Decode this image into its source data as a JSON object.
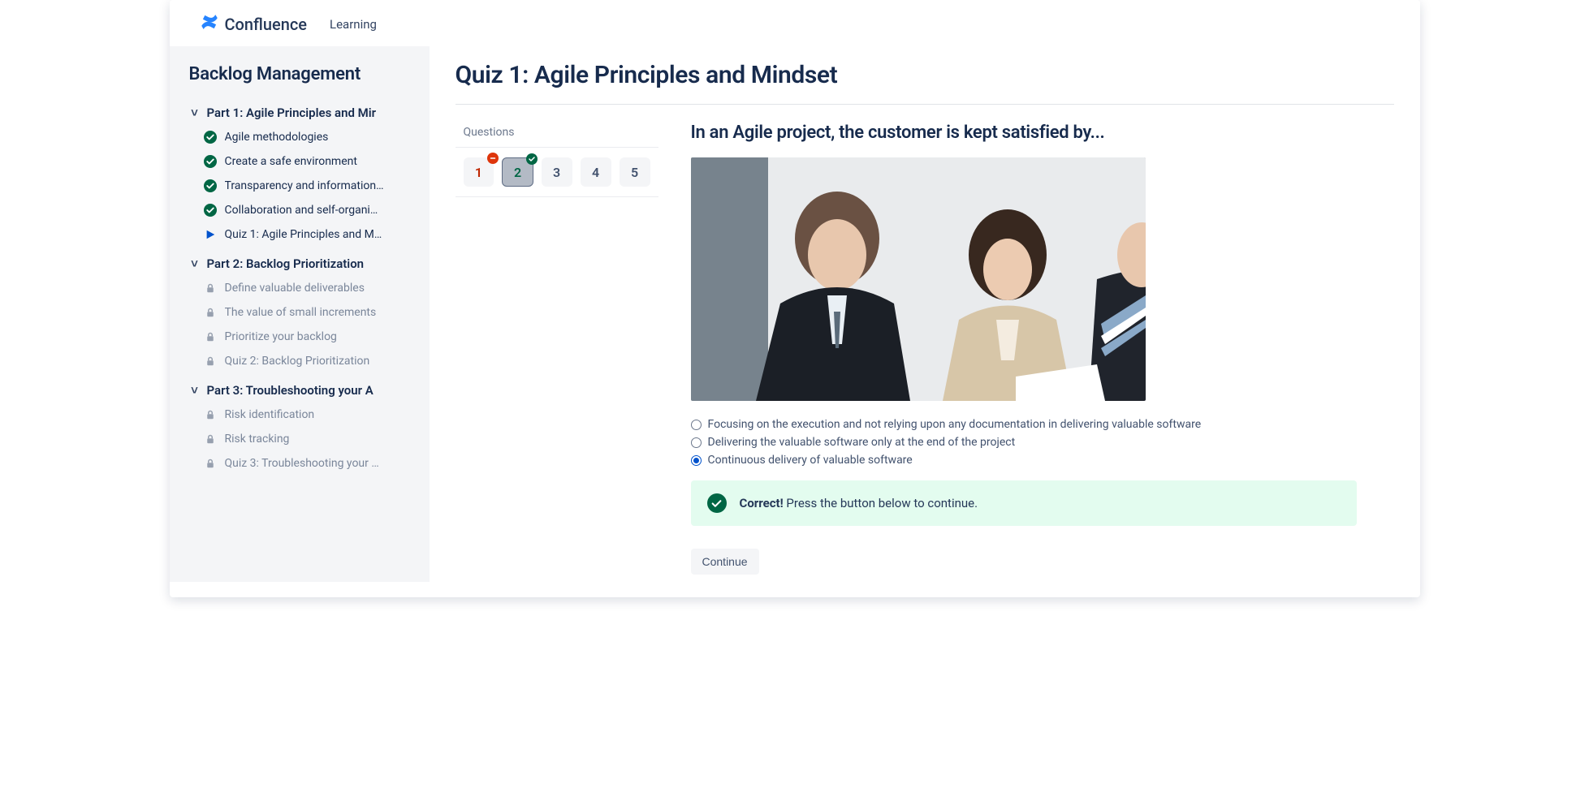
{
  "header": {
    "brand": "Confluence",
    "section": "Learning"
  },
  "sidebar": {
    "title": "Backlog Management",
    "parts": [
      {
        "label": "Part 1: Agile Principles and Mir",
        "items": [
          {
            "label": "Agile methodologies",
            "state": "done"
          },
          {
            "label": "Create a safe environment",
            "state": "done"
          },
          {
            "label": "Transparency and information…",
            "state": "done"
          },
          {
            "label": "Collaboration and self-organi…",
            "state": "done"
          },
          {
            "label": "Quiz 1: Agile Principles and M…",
            "state": "current"
          }
        ]
      },
      {
        "label": "Part 2: Backlog Prioritization",
        "items": [
          {
            "label": "Define valuable deliverables",
            "state": "locked"
          },
          {
            "label": "The value of small increments",
            "state": "locked"
          },
          {
            "label": "Prioritize your backlog",
            "state": "locked"
          },
          {
            "label": "Quiz 2: Backlog Prioritization",
            "state": "locked"
          }
        ]
      },
      {
        "label": "Part 3: Troubleshooting your A",
        "items": [
          {
            "label": "Risk identification",
            "state": "locked"
          },
          {
            "label": "Risk tracking",
            "state": "locked"
          },
          {
            "label": "Quiz 3: Troubleshooting your …",
            "state": "locked"
          }
        ]
      }
    ]
  },
  "quiz": {
    "title": "Quiz 1: Agile Principles and Mindset",
    "questions_label": "Questions",
    "chips": [
      {
        "num": "1",
        "status": "wrong"
      },
      {
        "num": "2",
        "status": "correct"
      },
      {
        "num": "3",
        "status": "open"
      },
      {
        "num": "4",
        "status": "open"
      },
      {
        "num": "5",
        "status": "open"
      }
    ],
    "question_text": "In an Agile project, the customer is kept satisfied by...",
    "options": [
      {
        "text": "Focusing on the execution and not relying upon any documentation in delivering valuable software",
        "selected": false
      },
      {
        "text": "Delivering the valuable software only at the end of the project",
        "selected": false
      },
      {
        "text": "Continuous delivery of valuable software",
        "selected": true
      }
    ],
    "feedback": {
      "title": "Correct!",
      "message": "Press the button below to continue."
    },
    "continue_label": "Continue"
  }
}
